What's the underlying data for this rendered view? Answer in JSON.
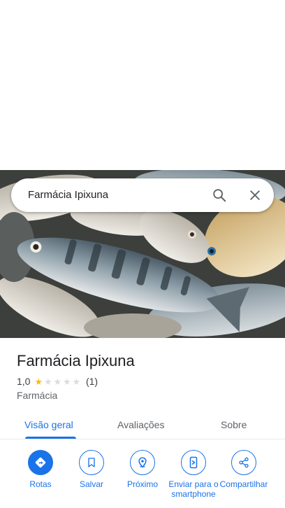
{
  "search": {
    "query": "Farmácia Ipixuna"
  },
  "place": {
    "name": "Farmácia Ipixuna",
    "rating": "1,0",
    "rating_value": 1,
    "rating_max": 5,
    "review_count": "(1)",
    "category": "Farmácia"
  },
  "tabs": [
    {
      "label": "Visão geral",
      "active": true
    },
    {
      "label": "Avaliações",
      "active": false
    },
    {
      "label": "Sobre",
      "active": false
    }
  ],
  "actions": [
    {
      "label": "Rotas",
      "icon": "directions-icon"
    },
    {
      "label": "Salvar",
      "icon": "bookmark-icon"
    },
    {
      "label": "Próximo",
      "icon": "nearby-icon"
    },
    {
      "label": "Enviar para o smartphone",
      "icon": "send-to-phone-icon"
    },
    {
      "label": "Compartilhar",
      "icon": "share-icon"
    }
  ],
  "colors": {
    "accent": "#1a73e8",
    "star": "#fbbc04"
  }
}
